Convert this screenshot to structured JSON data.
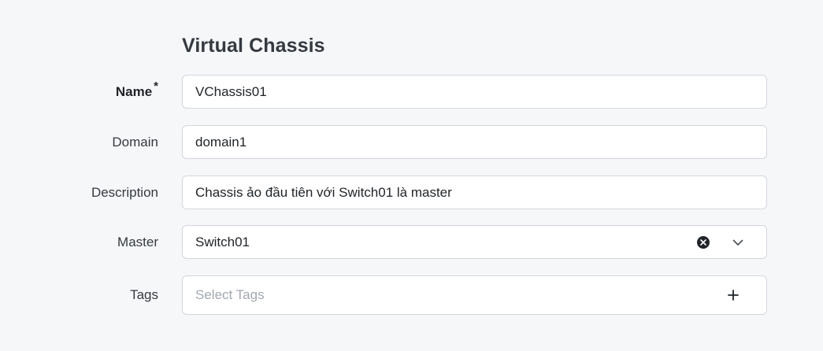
{
  "section": {
    "title": "Virtual Chassis"
  },
  "form": {
    "name": {
      "label": "Name",
      "required_mark": "*",
      "value": "VChassis01"
    },
    "domain": {
      "label": "Domain",
      "value": "domain1"
    },
    "description": {
      "label": "Description",
      "value": "Chassis ảo đầu tiên với Switch01 là master"
    },
    "master": {
      "label": "Master",
      "value": "Switch01",
      "clear_icon": "x-circle-icon",
      "expand_icon": "chevron-down-icon"
    },
    "tags": {
      "label": "Tags",
      "placeholder": "Select Tags",
      "add_icon": "plus-icon"
    }
  }
}
